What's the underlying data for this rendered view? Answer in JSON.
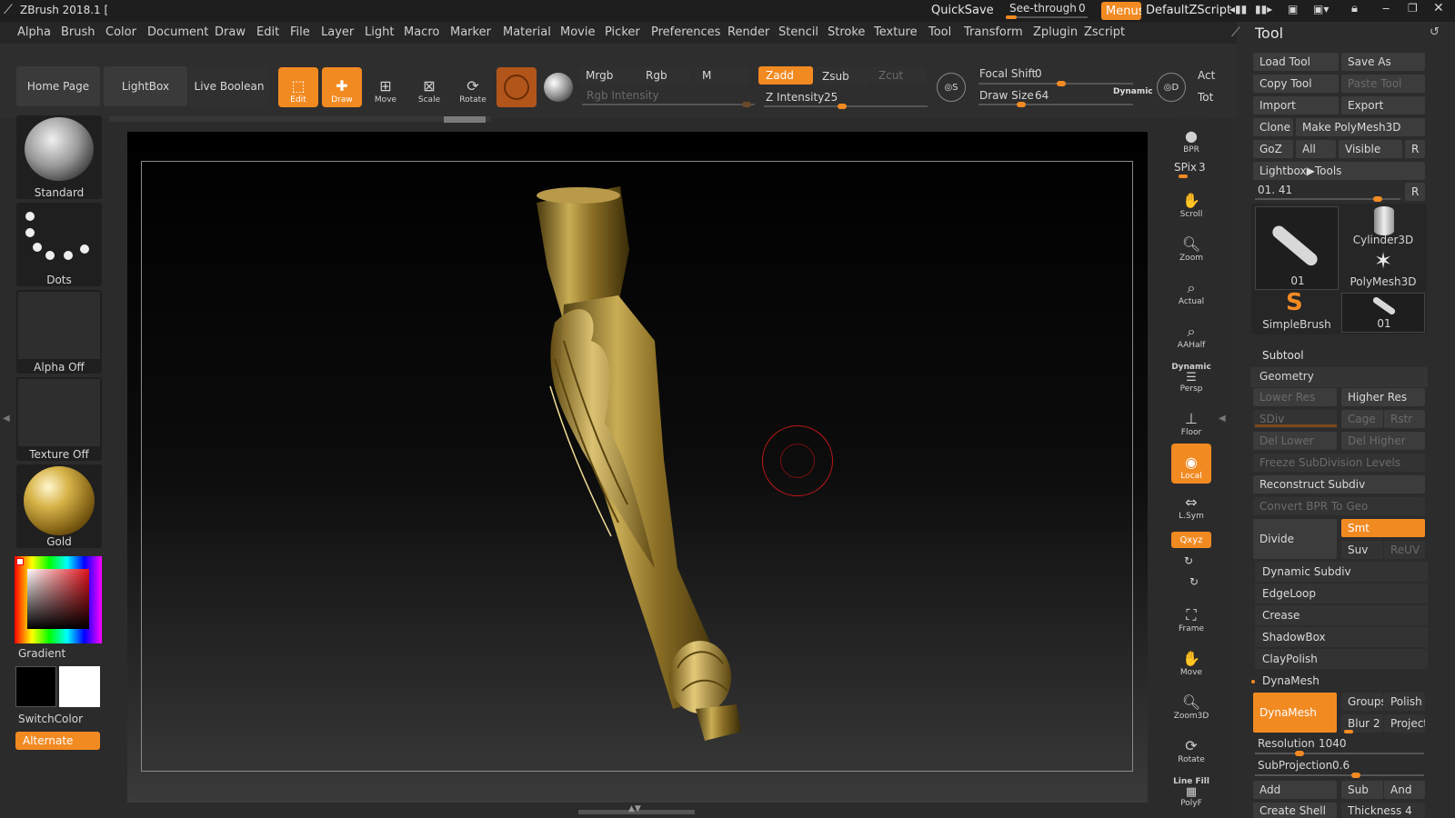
{
  "app": {
    "title": "ZBrush 2018.1 [",
    "quicksave": "QuickSave",
    "see_through_label": "See-through",
    "see_through_value": "0",
    "menus_label": "Menus",
    "script_label": "DefaultZScript"
  },
  "menu": [
    "Alpha",
    "Brush",
    "Color",
    "Document",
    "Draw",
    "Edit",
    "File",
    "Layer",
    "Light",
    "Macro",
    "Marker",
    "Material",
    "Movie",
    "Picker",
    "Preferences",
    "Render",
    "Stencil",
    "Stroke",
    "Texture",
    "Tool",
    "Transform",
    "Zplugin",
    "Zscript"
  ],
  "toolbar": {
    "home_page": "Home Page",
    "lightbox": "LightBox",
    "live_boolean": "Live Boolean",
    "edit": "Edit",
    "draw": "Draw",
    "move": "Move",
    "scale": "Scale",
    "rotate": "Rotate",
    "mrgb": "Mrgb",
    "rgb": "Rgb",
    "m": "M",
    "zadd": "Zadd",
    "zsub": "Zsub",
    "zcut": "Zcut",
    "rgb_intensity": "Rgb Intensity",
    "z_intensity_label": "Z Intensity",
    "z_intensity_value": "25",
    "focal_shift_label": "Focal Shift",
    "focal_shift_value": "0",
    "draw_size_label": "Draw Size",
    "draw_size_value": "64",
    "dynamic": "Dynamic",
    "act": "Act",
    "tot": "Tot"
  },
  "left_shelf": {
    "brush": "Standard",
    "stroke": "Dots",
    "alpha": "Alpha Off",
    "texture": "Texture Off",
    "material": "Gold",
    "gradient": "Gradient",
    "switch_color": "SwitchColor",
    "alternate": "Alternate"
  },
  "right_shelf": {
    "bpr": "BPR",
    "spix_label": "SPix",
    "spix_value": "3",
    "scroll": "Scroll",
    "zoom": "Zoom",
    "actual": "Actual",
    "aahalf": "AAHalf",
    "dynamic": "Dynamic",
    "persp": "Persp",
    "floor": "Floor",
    "local": "Local",
    "lsym": "L.Sym",
    "xyz": "Qxyz",
    "frame": "Frame",
    "move": "Move",
    "zoom3d": "Zoom3D",
    "rotate": "Rotate",
    "line_fill": "Line Fill",
    "polyf": "PolyF"
  },
  "tool_palette": {
    "title": "Tool",
    "load_tool": "Load Tool",
    "save_as": "Save As",
    "copy_tool": "Copy Tool",
    "paste_tool": "Paste Tool",
    "import": "Import",
    "export": "Export",
    "clone": "Clone",
    "make_polymesh": "Make PolyMesh3D",
    "goz": "GoZ",
    "all": "All",
    "visible": "Visible",
    "r": "R",
    "lightbox_tools": "Lightbox▶Tools",
    "current_tool": "01. 41",
    "thumbs": [
      "01",
      "Cylinder3D",
      "PolyMesh3D",
      "SimpleBrush",
      "01"
    ],
    "subtool": "Subtool",
    "geometry": "Geometry",
    "lower_res": "Lower Res",
    "higher_res": "Higher Res",
    "sdiv": "SDiv",
    "cage": "Cage",
    "rstr": "Rstr",
    "del_lower": "Del Lower",
    "del_higher": "Del Higher",
    "freeze_subdiv": "Freeze SubDivision Levels",
    "reconstruct_subdiv": "Reconstruct Subdiv",
    "convert_bpr": "Convert BPR To Geo",
    "divide": "Divide",
    "smt": "Smt",
    "suv": "Suv",
    "reuv": "ReUV",
    "dynamic_subdiv": "Dynamic Subdiv",
    "edgeloop": "EdgeLoop",
    "crease": "Crease",
    "shadowbox": "ShadowBox",
    "claypolish": "ClayPolish",
    "dynamesh_section": "DynaMesh",
    "dynamesh_btn": "DynaMesh",
    "groups": "Groups",
    "polish": "Polish",
    "blur_label": "Blur",
    "blur_value": "2",
    "project": "Project",
    "resolution_label": "Resolution",
    "resolution_value": "1040",
    "subprojection_label": "SubProjection",
    "subprojection_value": "0.6",
    "add": "Add",
    "sub": "Sub",
    "and": "And",
    "create_shell": "Create Shell",
    "thickness_label": "Thickness",
    "thickness_value": "4"
  },
  "colors": {
    "accent": "#f28a22",
    "gold": "#b89a4a"
  }
}
